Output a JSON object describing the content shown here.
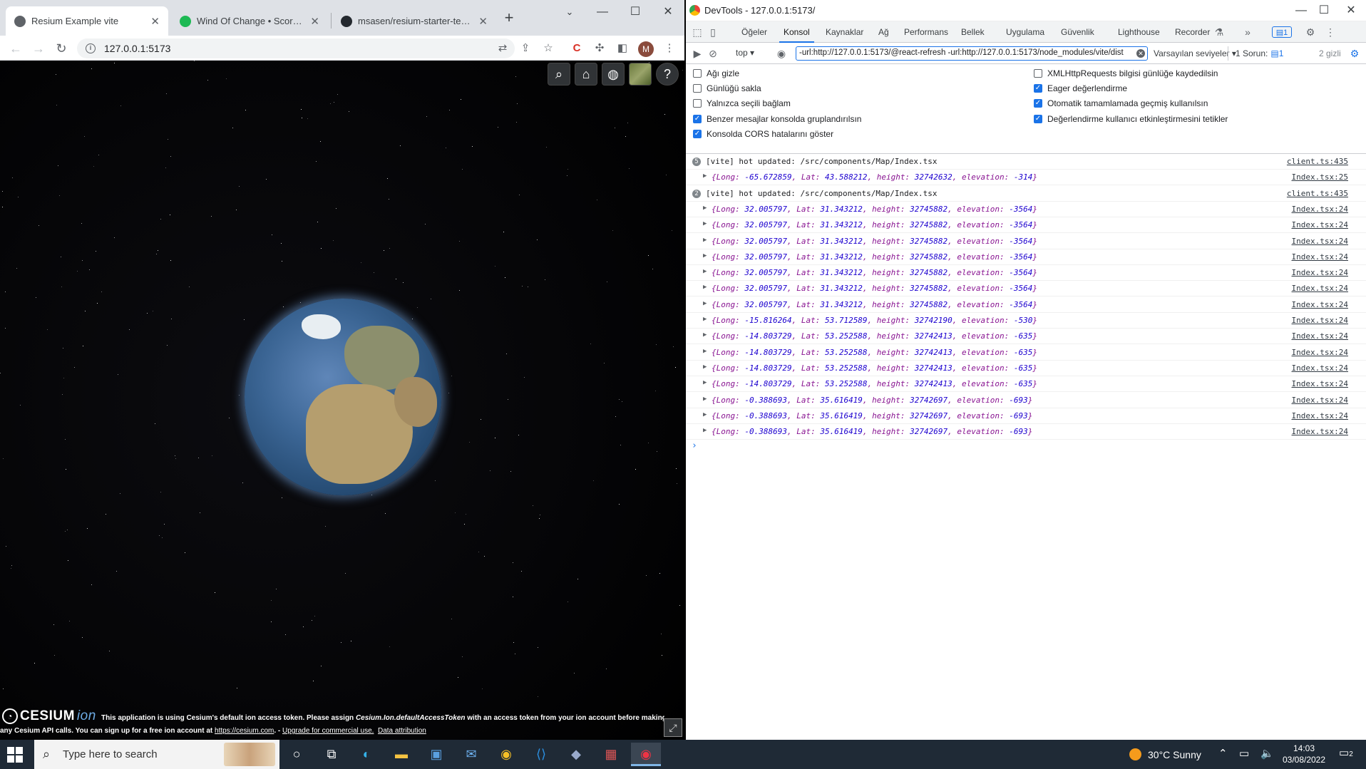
{
  "browser": {
    "tabs": [
      {
        "label": "Resium Example vite",
        "active": true
      },
      {
        "label": "Wind Of Change • Scorpions",
        "active": false
      },
      {
        "label": "msasen/resium-starter-templa",
        "active": false
      }
    ],
    "url": "127.0.0.1:5173",
    "profile_initial": "M"
  },
  "cesium": {
    "logo_text": "CESIUM",
    "logo_suffix": "ion",
    "credit_line1_prefix": "This application is using Cesium's default ion access token. Please assign ",
    "credit_line1_code": "Cesium.Ion.defaultAccessToken",
    "credit_line1_suffix": " with an access token from your ion account before making",
    "credit_line2_prefix": "any Cesium API calls. You can sign up for a free ion account at ",
    "credit_link": "https://cesium.com",
    "credit_line2_mid": ". - ",
    "upgrade_link": "Upgrade for commercial use.",
    "attribution_link": "Data attribution",
    "help_label": "?"
  },
  "devtools": {
    "title": "DevTools - 127.0.0.1:5173/",
    "tabs": [
      "Öğeler",
      "Konsol",
      "Kaynaklar",
      "Ağ",
      "Performans",
      "Bellek",
      "Uygulama",
      "Güvenlik",
      "Lighthouse",
      "Recorder"
    ],
    "active_tab": "Konsol",
    "badge_count": "1",
    "context": "top",
    "filter": "-url:http://127.0.0.1:5173/@react-refresh -url:http://127.0.0.1:5173/node_modules/vite/dist",
    "levels": "Varsayılan seviyeler",
    "issues_label": "1 Sorun:",
    "issues_badge": "1",
    "hidden": "2 gizli",
    "settings_left": [
      {
        "label": "Ağı gizle",
        "checked": false
      },
      {
        "label": "Günlüğü sakla",
        "checked": false
      },
      {
        "label": "Yalnızca seçili bağlam",
        "checked": false
      },
      {
        "label": "Benzer mesajlar konsolda gruplandırılsın",
        "checked": true
      },
      {
        "label": "Konsolda CORS hatalarını göster",
        "checked": true
      }
    ],
    "settings_right": [
      {
        "label": "XMLHttpRequests bilgisi günlüğe kaydedilsin",
        "checked": false
      },
      {
        "label": "Eager değerlendirme",
        "checked": true
      },
      {
        "label": "Otomatik tamamlamada geçmiş kullanılsın",
        "checked": true
      },
      {
        "label": "Değerlendirme kullanıcı etkinleştirmesini tetikler",
        "checked": true
      }
    ],
    "logs": [
      {
        "type": "vite",
        "count": "5",
        "text": "[vite] hot updated: /src/components/Map/Index.tsx",
        "src": "client.ts:435"
      },
      {
        "type": "obj",
        "long": "-65.672859",
        "lat": "43.588212",
        "height": "32742632",
        "elevation": "-314",
        "src": "Index.tsx:25"
      },
      {
        "type": "vite",
        "count": "2",
        "text": "[vite] hot updated: /src/components/Map/Index.tsx",
        "src": "client.ts:435"
      },
      {
        "type": "obj",
        "long": "32.005797",
        "lat": "31.343212",
        "height": "32745882",
        "elevation": "-3564",
        "src": "Index.tsx:24"
      },
      {
        "type": "obj",
        "long": "32.005797",
        "lat": "31.343212",
        "height": "32745882",
        "elevation": "-3564",
        "src": "Index.tsx:24"
      },
      {
        "type": "obj",
        "long": "32.005797",
        "lat": "31.343212",
        "height": "32745882",
        "elevation": "-3564",
        "src": "Index.tsx:24"
      },
      {
        "type": "obj",
        "long": "32.005797",
        "lat": "31.343212",
        "height": "32745882",
        "elevation": "-3564",
        "src": "Index.tsx:24"
      },
      {
        "type": "obj",
        "long": "32.005797",
        "lat": "31.343212",
        "height": "32745882",
        "elevation": "-3564",
        "src": "Index.tsx:24"
      },
      {
        "type": "obj",
        "long": "32.005797",
        "lat": "31.343212",
        "height": "32745882",
        "elevation": "-3564",
        "src": "Index.tsx:24"
      },
      {
        "type": "obj",
        "long": "32.005797",
        "lat": "31.343212",
        "height": "32745882",
        "elevation": "-3564",
        "src": "Index.tsx:24"
      },
      {
        "type": "obj",
        "long": "-15.816264",
        "lat": "53.712589",
        "height": "32742190",
        "elevation": "-530",
        "src": "Index.tsx:24"
      },
      {
        "type": "obj",
        "long": "-14.803729",
        "lat": "53.252588",
        "height": "32742413",
        "elevation": "-635",
        "src": "Index.tsx:24"
      },
      {
        "type": "obj",
        "long": "-14.803729",
        "lat": "53.252588",
        "height": "32742413",
        "elevation": "-635",
        "src": "Index.tsx:24"
      },
      {
        "type": "obj",
        "long": "-14.803729",
        "lat": "53.252588",
        "height": "32742413",
        "elevation": "-635",
        "src": "Index.tsx:24"
      },
      {
        "type": "obj",
        "long": "-14.803729",
        "lat": "53.252588",
        "height": "32742413",
        "elevation": "-635",
        "src": "Index.tsx:24"
      },
      {
        "type": "obj",
        "long": "-0.388693",
        "lat": "35.616419",
        "height": "32742697",
        "elevation": "-693",
        "src": "Index.tsx:24"
      },
      {
        "type": "obj",
        "long": "-0.388693",
        "lat": "35.616419",
        "height": "32742697",
        "elevation": "-693",
        "src": "Index.tsx:24"
      },
      {
        "type": "obj",
        "long": "-0.388693",
        "lat": "35.616419",
        "height": "32742697",
        "elevation": "-693",
        "src": "Index.tsx:24"
      }
    ]
  },
  "taskbar": {
    "search_placeholder": "Type here to search",
    "weather": "30°C  Sunny",
    "time": "14:03",
    "date": "03/08/2022",
    "notifications": "2"
  },
  "colors": {
    "accent": "#1a73e8",
    "taskbar": "#1f2a36"
  }
}
